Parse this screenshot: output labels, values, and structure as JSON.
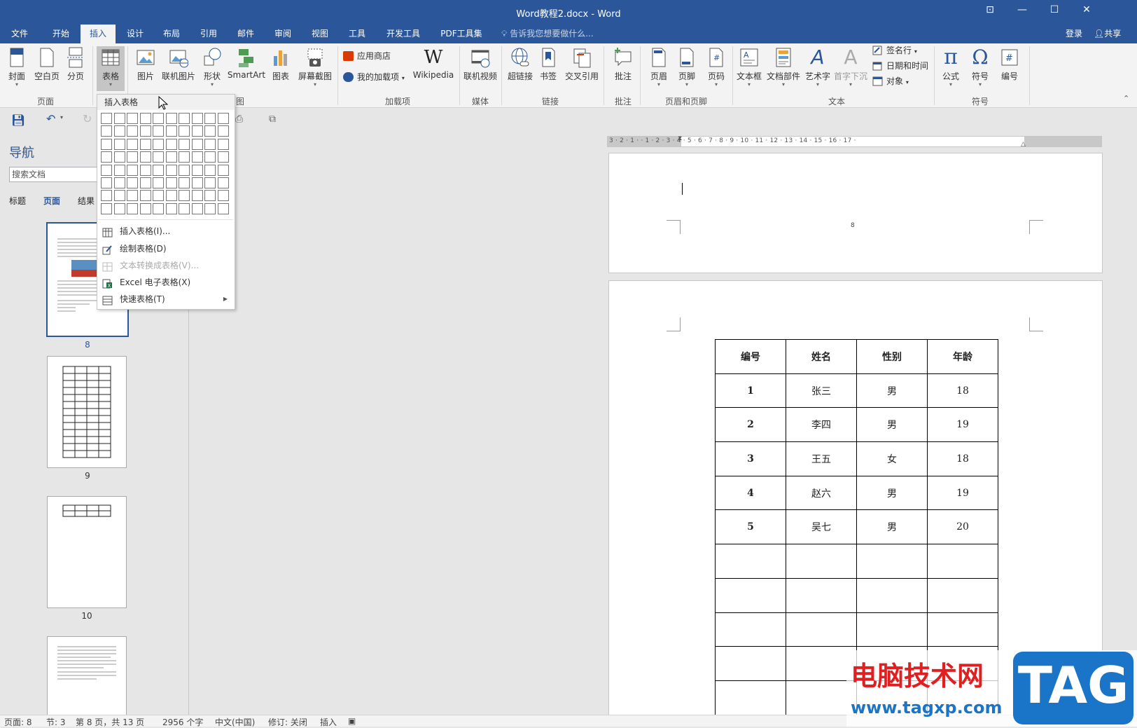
{
  "window": {
    "title": "Word教程2.docx - Word"
  },
  "tabs": [
    "文件",
    "开始",
    "插入",
    "设计",
    "布局",
    "引用",
    "邮件",
    "审阅",
    "视图",
    "工具",
    "开发工具",
    "PDF工具集"
  ],
  "active_tab": "插入",
  "tell_me": "告诉我您想要做什么...",
  "account": {
    "login": "登录",
    "share": "共享"
  },
  "ribbon": {
    "page_group": {
      "label": "页面",
      "cover": "封面",
      "blank": "空白页",
      "break": "分页"
    },
    "table_group": {
      "table": "表格"
    },
    "illustrations": {
      "picture": "图片",
      "online_picture": "联机图片",
      "shapes": "形状",
      "smartart": "SmartArt",
      "chart": "图表",
      "screenshot": "屏幕截图",
      "label_tail": "图"
    },
    "addins": {
      "label": "加载项",
      "store": "应用商店",
      "my_addins": "我的加载项",
      "wikipedia": "Wikipedia"
    },
    "media": {
      "label": "媒体",
      "online_video": "联机视频"
    },
    "links": {
      "label": "链接",
      "hyperlink": "超链接",
      "bookmark": "书签",
      "crossref": "交叉引用"
    },
    "comments": {
      "label": "批注",
      "comment": "批注"
    },
    "header_footer": {
      "label": "页眉和页脚",
      "header": "页眉",
      "footer": "页脚",
      "page_number": "页码"
    },
    "text": {
      "label": "文本",
      "textbox": "文本框",
      "quickparts": "文档部件",
      "wordart": "艺术字",
      "dropcap": "首字下沉",
      "signature": "签名行",
      "datetime": "日期和时间",
      "object": "对象"
    },
    "symbols": {
      "label": "符号",
      "equation": "公式",
      "symbol": "符号",
      "numbering": "编号"
    }
  },
  "navigation": {
    "title": "导航",
    "search_placeholder": "搜索文档",
    "tabs": [
      "标题",
      "页面",
      "结果"
    ],
    "thumbnails": [
      "8",
      "9",
      "10"
    ]
  },
  "table_menu": {
    "header": "插入表格",
    "items": [
      {
        "label": "插入表格(I)...",
        "disabled": false
      },
      {
        "label": "绘制表格(D)",
        "disabled": false
      },
      {
        "label": "文本转换成表格(V)...",
        "disabled": true
      },
      {
        "label": "Excel 电子表格(X)",
        "disabled": false
      },
      {
        "label": "快速表格(T)",
        "disabled": false
      }
    ]
  },
  "document": {
    "page_number": "8",
    "ruler": "3 · 2 · 1 · · 1 · 2 · 3 · 4 · 5 · 6 · 7 · 8 · 9 · 10 · 11 · 12 · 13 · 14 · 15 · 16 · 17 ·",
    "table": {
      "headers": [
        "编号",
        "姓名",
        "性别",
        "年龄"
      ],
      "rows": [
        [
          "1",
          "张三",
          "男",
          "18"
        ],
        [
          "2",
          "李四",
          "男",
          "19"
        ],
        [
          "3",
          "王五",
          "女",
          "18"
        ],
        [
          "4",
          "赵六",
          "男",
          "19"
        ],
        [
          "5",
          "吴七",
          "男",
          "20"
        ],
        [
          "",
          "",
          "",
          ""
        ],
        [
          "",
          "",
          "",
          ""
        ],
        [
          "",
          "",
          "",
          ""
        ],
        [
          "",
          "",
          "",
          ""
        ],
        [
          "",
          "",
          "",
          ""
        ]
      ]
    }
  },
  "status": {
    "page": "页面: 8",
    "section": "节: 3",
    "pageof": "第 8 页，共 13 页",
    "words": "2956 个字",
    "language": "中文(中国)",
    "track": "修订: 关闭",
    "mode": "插入"
  },
  "watermark": {
    "site_name": "电脑技术网",
    "url": "www.tagxp.com",
    "logo": "TAG"
  },
  "colors": {
    "accent": "#2b579a",
    "watermark_red": "#e02020",
    "watermark_blue": "#1a75c8"
  }
}
